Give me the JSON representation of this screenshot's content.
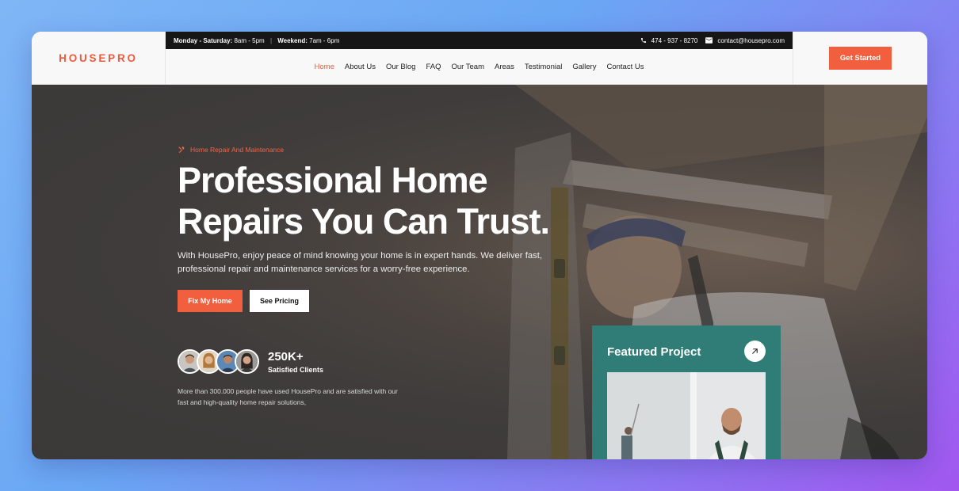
{
  "brand": {
    "logo": "HOUSEPRO",
    "accent": "#f15f3f"
  },
  "topbar": {
    "hours_weekday_label": "Monday - Saturday:",
    "hours_weekday_value": "8am - 5pm",
    "hours_weekend_label": "Weekend:",
    "hours_weekend_value": "7am - 6pm",
    "phone": "474 - 937 - 8270",
    "email": "contact@housepro.com"
  },
  "nav": {
    "items": [
      "Home",
      "About Us",
      "Our Blog",
      "FAQ",
      "Our Team",
      "Areas",
      "Testimonial",
      "Gallery",
      "Contact Us"
    ],
    "active": "Home"
  },
  "cta": {
    "get_started": "Get Started"
  },
  "hero": {
    "eyebrow": "Home Repair And Maintenance",
    "title_line1": "Professional Home",
    "title_line2": "Repairs You Can Trust.",
    "description": "With HousePro, enjoy peace of mind knowing your home is in expert hands. We deliver fast, professional repair and maintenance services for a worry-free experience.",
    "primary_button": "Fix My Home",
    "secondary_button": "See Pricing",
    "clients_count": "250K+",
    "clients_label": "Satisfied Clients",
    "clients_description": "More than 300.000 people have used HousePro and are satisfied with our fast and high-quality home repair solutions,"
  },
  "featured": {
    "title": "Featured Project",
    "card_color": "#2f7d76"
  }
}
